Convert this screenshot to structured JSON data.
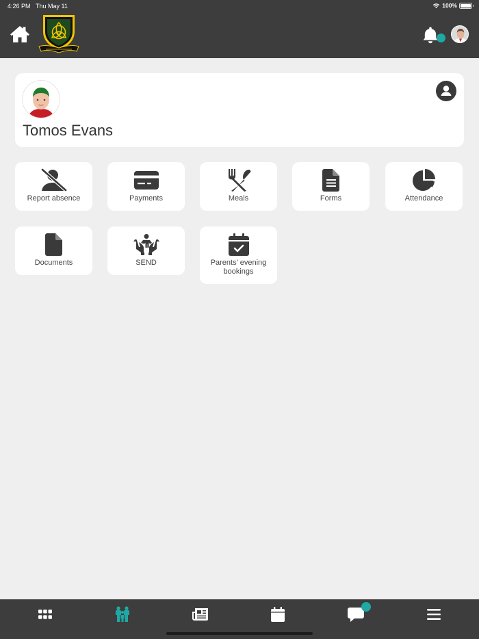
{
  "status_bar": {
    "time": "4:26 PM",
    "date": "Thu May 11",
    "battery": "100%"
  },
  "header": {
    "home_icon": "home-icon",
    "logo": "school-crest",
    "notifications_icon": "bell-icon",
    "notification_badge": true,
    "user_avatar": "user-avatar"
  },
  "child": {
    "name": "Tomos Evans",
    "photo": "child-photo",
    "profile_icon": "user-circle-icon"
  },
  "tiles": [
    {
      "label": "Report absence",
      "icon": "user-slash-icon"
    },
    {
      "label": "Payments",
      "icon": "credit-card-icon"
    },
    {
      "label": "Meals",
      "icon": "utensils-icon"
    },
    {
      "label": "Forms",
      "icon": "file-text-icon"
    },
    {
      "label": "Attendance",
      "icon": "pie-chart-icon"
    },
    {
      "label": "Documents",
      "icon": "file-icon"
    },
    {
      "label": "SEND",
      "icon": "hands-child-icon"
    },
    {
      "label": "Parents' evening bookings",
      "icon": "calendar-check-icon"
    }
  ],
  "tab_bar": {
    "tabs": [
      {
        "icon": "grid-icon",
        "active": false
      },
      {
        "icon": "family-icon",
        "active": true
      },
      {
        "icon": "newspaper-icon",
        "active": false
      },
      {
        "icon": "calendar-icon",
        "active": false
      },
      {
        "icon": "chat-icon",
        "active": false,
        "badge": true
      },
      {
        "icon": "menu-icon",
        "active": false
      }
    ]
  },
  "colors": {
    "bar": "#3d3d3d",
    "accent": "#1fa9a4",
    "background": "#efefef",
    "icon": "#3a3a3a"
  }
}
